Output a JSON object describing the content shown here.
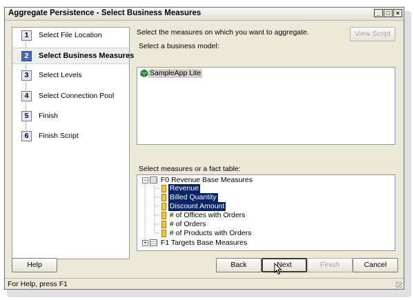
{
  "window": {
    "title": "Aggregate Persistence - Select Business Measures"
  },
  "title_buttons": {
    "minimize": "_",
    "maximize": "□",
    "close": "×"
  },
  "steps": [
    {
      "num": "1",
      "label": "Select File Location"
    },
    {
      "num": "2",
      "label": "Select Business Measures",
      "active": true
    },
    {
      "num": "3",
      "label": "Select Levels"
    },
    {
      "num": "4",
      "label": "Select Connection Pool"
    },
    {
      "num": "5",
      "label": "Finish"
    },
    {
      "num": "6",
      "label": "Finish Script"
    }
  ],
  "main": {
    "instruction": "Select the measures on which you want to aggregate.",
    "view_script": "View Script",
    "model_label": "Select a business model:",
    "models": [
      {
        "label": "SampleApp Lite",
        "selected": true
      }
    ],
    "measures_label": "Select measures or a fact table:",
    "tree": [
      {
        "label": "F0 Revenue Base Measures",
        "level": 0,
        "type": "table",
        "expander": "−"
      },
      {
        "label": "Revenue",
        "level": 1,
        "type": "measure",
        "selected": true
      },
      {
        "label": "Billed Quantity",
        "level": 1,
        "type": "measure",
        "selected": true
      },
      {
        "label": "Discount Amount",
        "level": 1,
        "type": "measure",
        "selected": true
      },
      {
        "label": "# of Offices with Orders",
        "level": 1,
        "type": "measure"
      },
      {
        "label": "# of Orders",
        "level": 1,
        "type": "measure"
      },
      {
        "label": "# of Products with Orders",
        "level": 1,
        "type": "measure"
      },
      {
        "label": "F1 Targets Base Measures",
        "level": 0,
        "type": "table",
        "expander": "+"
      }
    ]
  },
  "buttons": {
    "help": "Help",
    "back": "Back",
    "next": "Next",
    "finish": "Finish",
    "cancel": "Cancel"
  },
  "status": "For Help, press F1"
}
